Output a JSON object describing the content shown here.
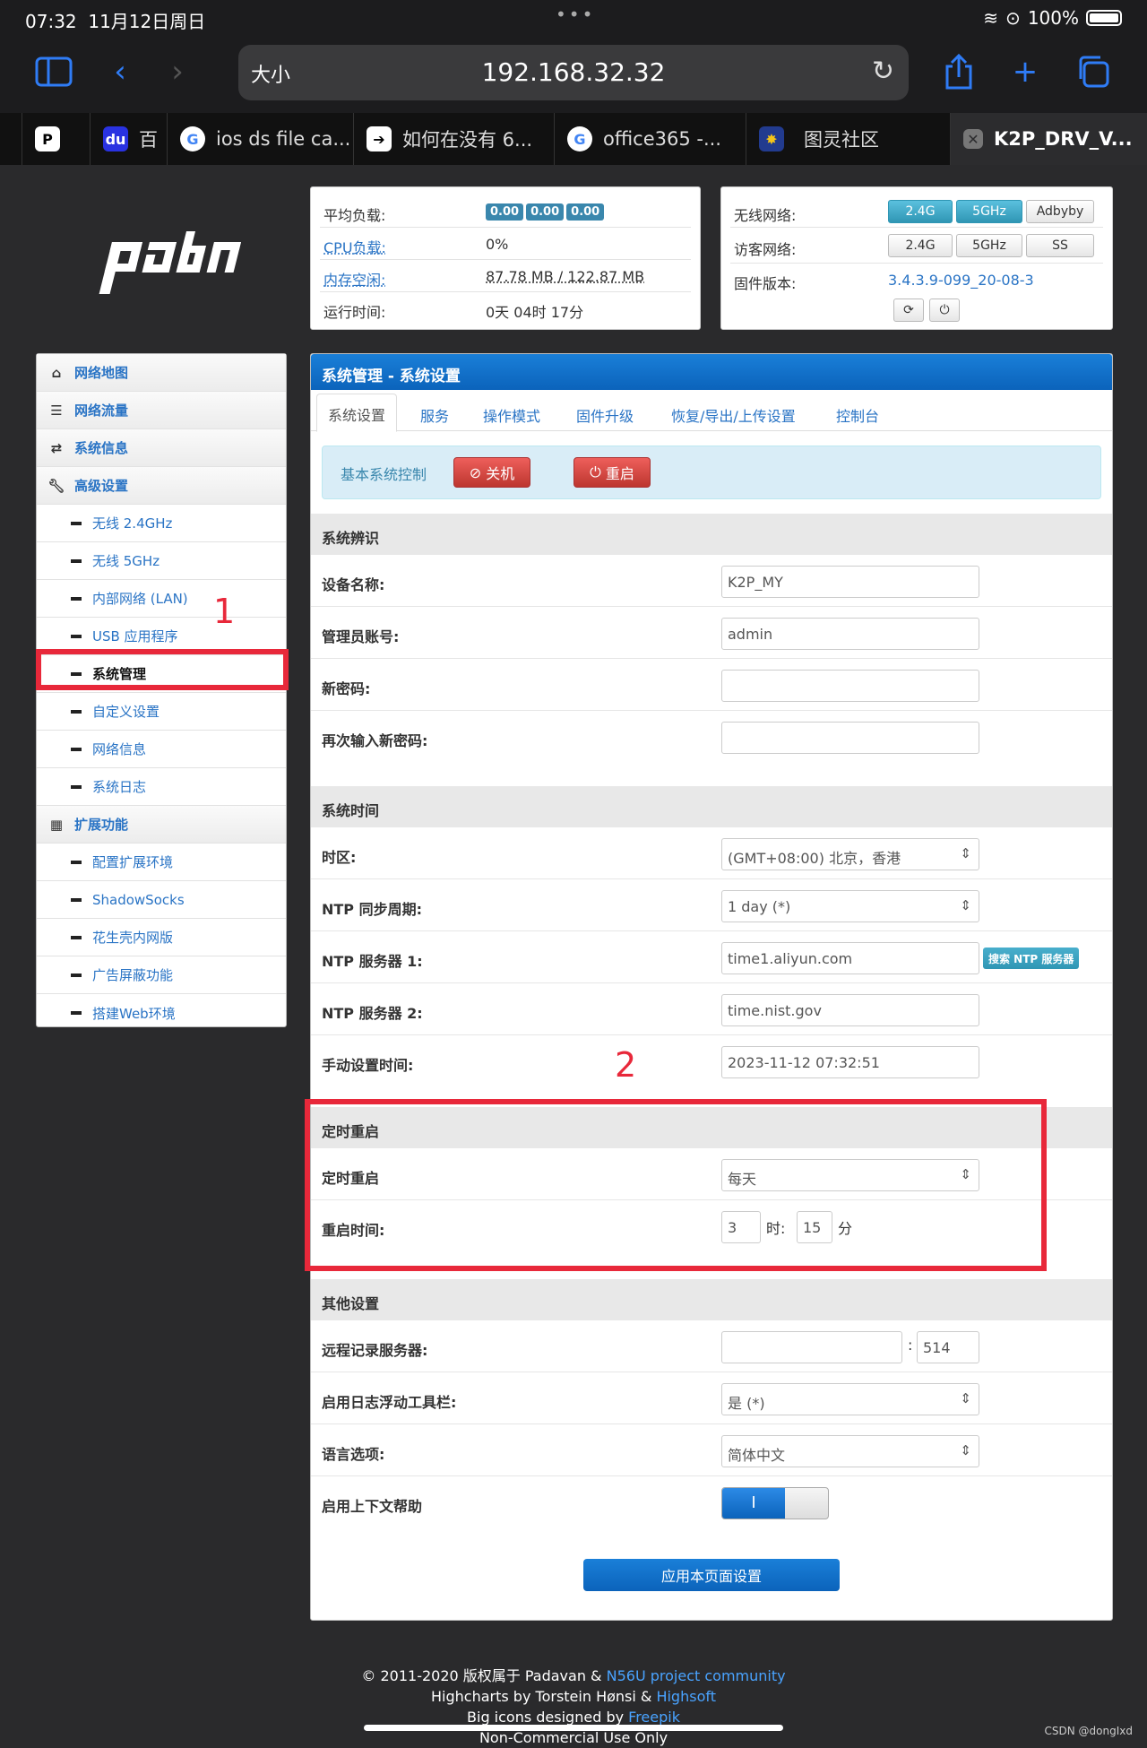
{
  "status_bar": {
    "time": "07:32",
    "date": "11月12日周日",
    "battery": "100%"
  },
  "browser": {
    "aa_label": "大小",
    "url": "192.168.32.32",
    "tabs": [
      {
        "icon": "pdf-icon",
        "label": ""
      },
      {
        "icon": "baidu-icon",
        "label": "百"
      },
      {
        "icon": "google-icon",
        "label": "ios ds file ca..."
      },
      {
        "icon": "arrow-icon",
        "label": "如何在没有 6..."
      },
      {
        "icon": "google-icon",
        "label": "office365 -..."
      },
      {
        "icon": "turing-icon",
        "label": "图灵社区"
      },
      {
        "icon": "close-icon",
        "label": "K2P_DRV_V..."
      }
    ]
  },
  "logo_text": "padavan",
  "stats": {
    "load_label": "平均负载:",
    "load_values": [
      "0.00",
      "0.00",
      "0.00"
    ],
    "cpu_label": "CPU负载:",
    "cpu_value": "0%",
    "mem_label": "内存空闲:",
    "mem_value": "87.78 MB / 122.87 MB",
    "uptime_label": "运行时间:",
    "uptime_value": "0天 04时 17分"
  },
  "wireless": {
    "wifi_label": "无线网络:",
    "wifi_buttons": [
      "2.4G",
      "5GHz",
      "Adbyby"
    ],
    "guest_label": "访客网络:",
    "guest_buttons": [
      "2.4G",
      "5GHz",
      "SS"
    ],
    "fw_label": "固件版本:",
    "fw_value": "3.4.3.9-099_20-08-3"
  },
  "sidebar": {
    "items": [
      {
        "label": "网络地图",
        "type": "top",
        "icon": "home-icon"
      },
      {
        "label": "网络流量",
        "type": "top",
        "icon": "database-icon"
      },
      {
        "label": "系统信息",
        "type": "top",
        "icon": "shuffle-icon"
      },
      {
        "label": "高级设置",
        "type": "top",
        "icon": "wrench-icon"
      },
      {
        "label": "无线 2.4GHz",
        "type": "sub"
      },
      {
        "label": "无线 5GHz",
        "type": "sub"
      },
      {
        "label": "内部网络 (LAN)",
        "type": "sub"
      },
      {
        "label": "USB 应用程序",
        "type": "sub"
      },
      {
        "label": "系统管理",
        "type": "sub",
        "current": true
      },
      {
        "label": "自定义设置",
        "type": "sub"
      },
      {
        "label": "网络信息",
        "type": "sub"
      },
      {
        "label": "系统日志",
        "type": "sub"
      },
      {
        "label": "扩展功能",
        "type": "top",
        "icon": "grid-icon"
      },
      {
        "label": "配置扩展环境",
        "type": "sub"
      },
      {
        "label": "ShadowSocks",
        "type": "sub"
      },
      {
        "label": "花生壳内网版",
        "type": "sub"
      },
      {
        "label": "广告屏蔽功能",
        "type": "sub"
      },
      {
        "label": "搭建Web环境",
        "type": "sub"
      }
    ]
  },
  "main": {
    "title": "系统管理 - 系统设置",
    "tabs": [
      "系统设置",
      "服务",
      "操作模式",
      "固件升级",
      "恢复/导出/上传设置",
      "控制台"
    ],
    "basic_control_label": "基本系统控制",
    "shutdown_label": "关机",
    "reboot_label": "重启",
    "section_ident": "系统辨识",
    "device_name_label": "设备名称:",
    "device_name_value": "K2P_MY",
    "admin_label": "管理员账号:",
    "admin_value": "admin",
    "new_pw_label": "新密码:",
    "new_pw_value": "",
    "confirm_pw_label": "再次输入新密码:",
    "confirm_pw_value": "",
    "section_time": "系统时间",
    "tz_label": "时区:",
    "tz_value": "(GMT+08:00) 北京，香港",
    "ntp_period_label": "NTP 同步周期:",
    "ntp_period_value": "1 day (*)",
    "ntp1_label": "NTP 服务器 1:",
    "ntp1_value": "time1.aliyun.com",
    "ntp_search_label": "搜索 NTP 服务器",
    "ntp2_label": "NTP 服务器 2:",
    "ntp2_value": "time.nist.gov",
    "manual_time_label": "手动设置时间:",
    "manual_time_value": "2023-11-12 07:32:51",
    "section_reboot": "定时重启",
    "sched_reboot_label": "定时重启",
    "sched_reboot_value": "每天",
    "reboot_time_label": "重启时间:",
    "reboot_hour": "3",
    "hour_unit": "时:",
    "reboot_min": "15",
    "min_unit": "分",
    "section_other": "其他设置",
    "syslog_label": "远程记录服务器:",
    "syslog_host": "",
    "syslog_colon": ":",
    "syslog_port": "514",
    "log_toolbar_label": "启用日志浮动工具栏:",
    "log_toolbar_value": "是 (*)",
    "lang_label": "语言选项:",
    "lang_value": "简体中文",
    "ctx_help_label": "启用上下文帮助",
    "ctx_help_on": "I",
    "apply_label": "应用本页面设置"
  },
  "annotations": {
    "num1": "1",
    "num2": "2"
  },
  "footer": {
    "line1_text": "© 2011-2020 版权属于 Padavan & ",
    "line1_link": "N56U project community",
    "line2_text": "Highcharts by Torstein Hønsi & ",
    "line2_link": "Highsoft",
    "line3_text": "Big icons designed by ",
    "line3_link": "Freepik",
    "line4_text": "Non-Commercial Use Only"
  },
  "watermark": "CSDN @dongIxd",
  "colors": {
    "accent": "#0b63bb",
    "annotation": "#e8283a",
    "danger": "#bd362f",
    "info": "#2f96b4"
  }
}
